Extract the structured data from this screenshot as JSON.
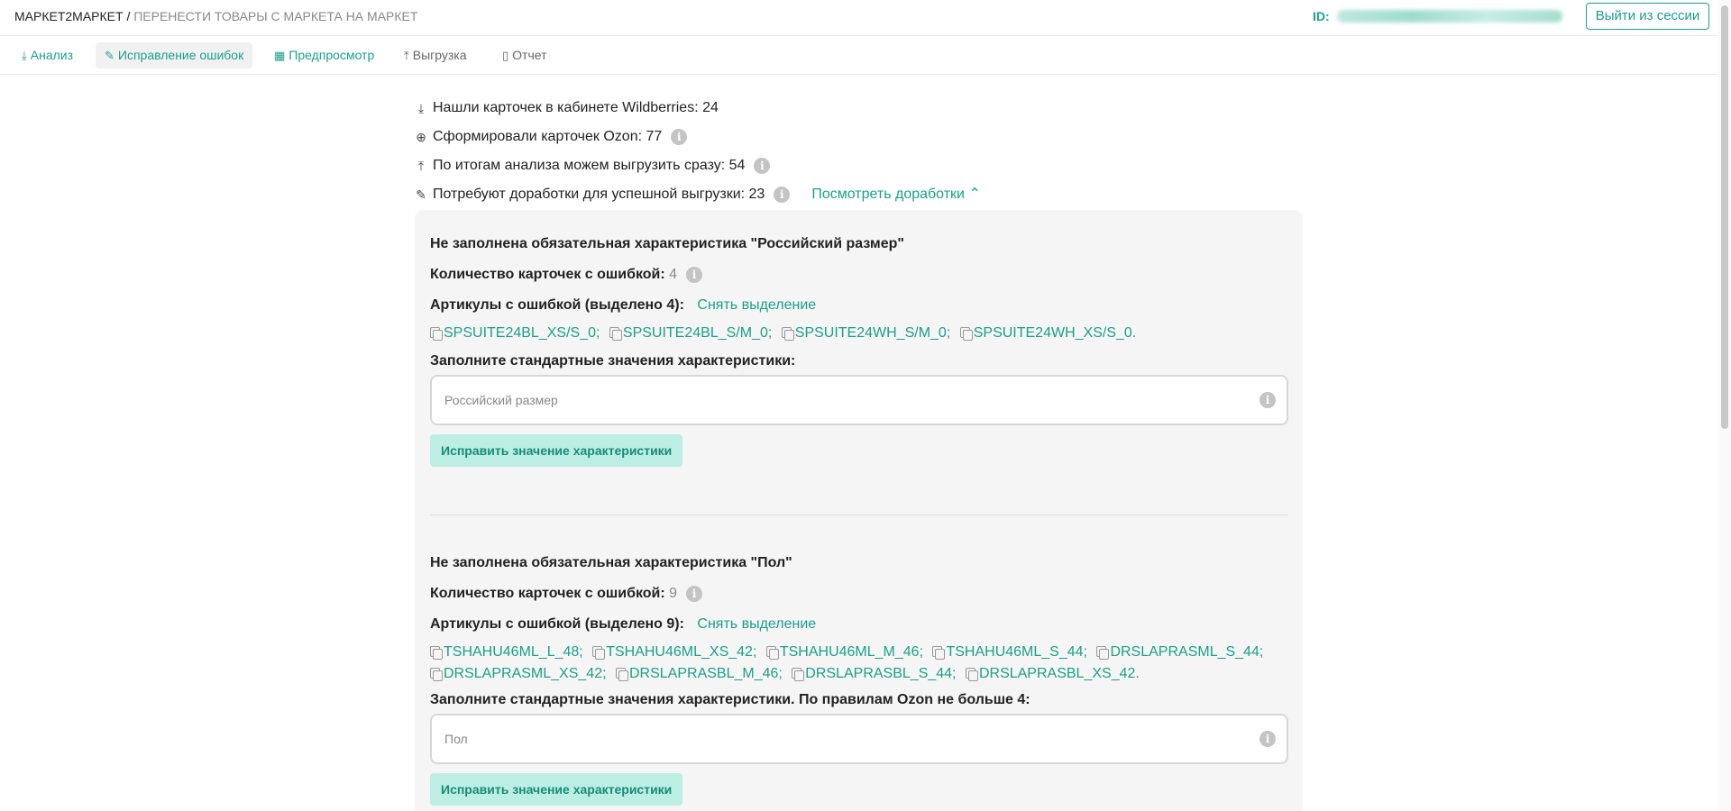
{
  "header": {
    "brand": "МАРКЕТ2МАРКЕТ",
    "separator": " / ",
    "subtitle": "ПЕРЕНЕСТИ ТОВАРЫ С МАРКЕТА НА МАРКЕТ",
    "id_label": "ID:",
    "logout_label": "Выйти из сессии"
  },
  "tabs": [
    {
      "label": "Анализ",
      "icon": "download-icon"
    },
    {
      "label": "Исправление ошибок",
      "icon": "pencil-icon"
    },
    {
      "label": "Предпросмотр",
      "icon": "grid-icon"
    },
    {
      "label": "Выгрузка",
      "icon": "upload-icon"
    },
    {
      "label": "Отчет",
      "icon": "clipboard-icon"
    }
  ],
  "stats": [
    {
      "label": "Нашли карточек в кабинете Wildberries:",
      "value": "24",
      "icon": "download-icon"
    },
    {
      "label": "Сформировали карточек Ozon:",
      "value": "77",
      "icon": "plus-circle-icon"
    },
    {
      "label": "По итогам анализа можем выгрузить сразу:",
      "value": "54",
      "icon": "upload-icon"
    },
    {
      "label": "Потребуют доработки для успешной выгрузки:",
      "value": "23",
      "icon": "pencil-icon"
    }
  ],
  "view_fixes_label": "Посмотреть доработки",
  "errors": [
    {
      "title": "Не заполнена обязательная характеристика \"Российский размер\"",
      "count_label": "Количество карточек с ошибкой:",
      "count": "4",
      "articles_label": "Артикулы с ошибкой (выделено 4):",
      "deselect_label": "Снять выделение",
      "articles": [
        "SPSUITE24BL_XS/S_0;",
        "SPSUITE24BL_S/M_0;",
        "SPSUITE24WH_S/M_0;",
        "SPSUITE24WH_XS/S_0."
      ],
      "fill_label": "Заполните стандартные значения характеристики:",
      "placeholder": "Российский размер",
      "button_label": "Исправить значение характеристики"
    },
    {
      "title": "Не заполнена обязательная характеристика \"Пол\"",
      "count_label": "Количество карточек с ошибкой:",
      "count": "9",
      "articles_label": "Артикулы с ошибкой (выделено 9):",
      "deselect_label": "Снять выделение",
      "articles": [
        "TSHAHU46ML_L_48;",
        "TSHAHU46ML_XS_42;",
        "TSHAHU46ML_M_46;",
        "TSHAHU46ML_S_44;",
        "DRSLAPRASML_S_44;",
        "DRSLAPRASML_XS_42;",
        "DRSLAPRASBL_M_46;",
        "DRSLAPRASBL_S_44;",
        "DRSLAPRASBL_XS_42."
      ],
      "fill_label": "Заполните стандартные значения характеристики. По правилам Ozon не больше 4:",
      "placeholder": "Пол",
      "button_label": "Исправить значение характеристики"
    }
  ],
  "colors": {
    "accent": "#1aa08a",
    "button_bg": "#bdeee3",
    "panel_bg": "#f5f5f5"
  }
}
